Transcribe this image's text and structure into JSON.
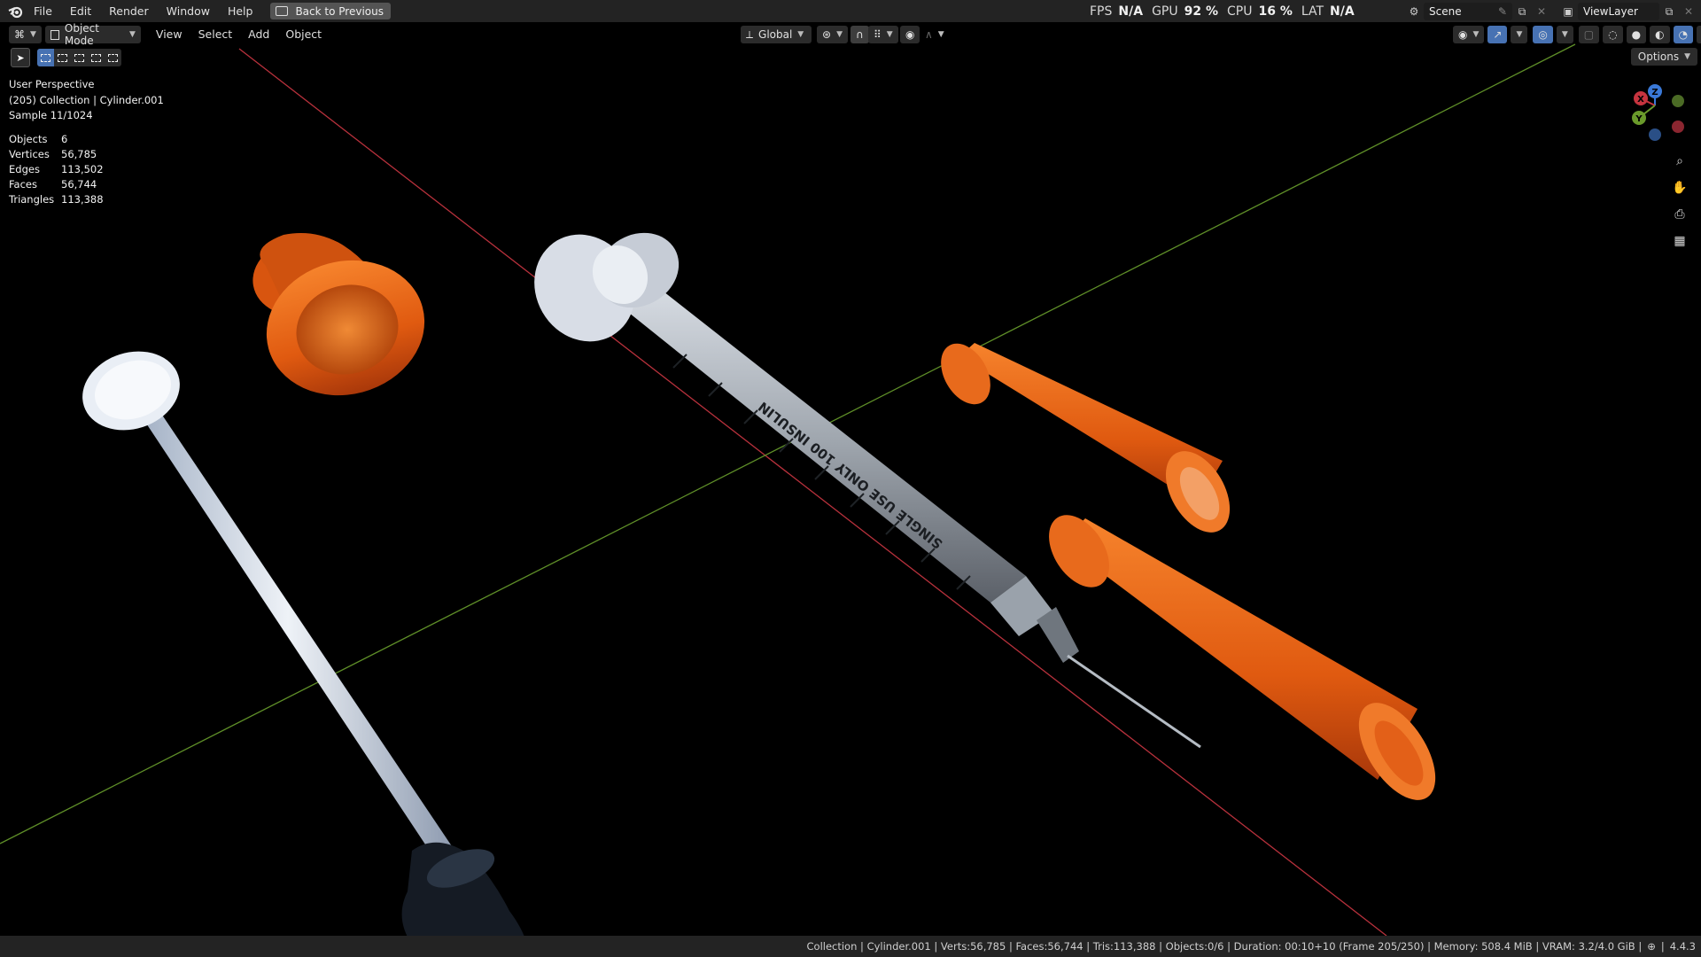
{
  "topbar": {
    "menus": [
      "File",
      "Edit",
      "Render",
      "Window",
      "Help"
    ],
    "back_label": "Back to Previous",
    "fps_label": "FPS",
    "fps_value": "N/A",
    "gpu_label": "GPU",
    "gpu_value": "92 %",
    "cpu_label": "CPU",
    "cpu_value": "16 %",
    "lat_label": "LAT",
    "lat_value": "N/A",
    "scene_name": "Scene",
    "view_layer": "ViewLayer"
  },
  "header": {
    "mode": "Object Mode",
    "menus": [
      "View",
      "Select",
      "Add",
      "Object"
    ],
    "transform_orientation": "Global",
    "options_label": "Options"
  },
  "viewport": {
    "perspective": "User Perspective",
    "collection_line": "(205) Collection | Cylinder.001",
    "sample": "Sample 11/1024",
    "stats": [
      {
        "label": "Objects",
        "value": "6"
      },
      {
        "label": "Vertices",
        "value": "56,785"
      },
      {
        "label": "Edges",
        "value": "113,502"
      },
      {
        "label": "Faces",
        "value": "56,744"
      },
      {
        "label": "Triangles",
        "value": "113,388"
      }
    ],
    "syringe_text": "SINGLE USE ONLY 100 INSULIN",
    "gizmo_axes": {
      "x": "X",
      "y": "Y",
      "z": "Z"
    },
    "colors": {
      "x_axis": "#c6343f",
      "y_axis": "#6a9a2b",
      "z_axis": "#3a79d8",
      "cap": "#e8641a"
    }
  },
  "statusbar": {
    "text": "Collection | Cylinder.001 | Verts:56,785 | Faces:56,744 | Tris:113,388 | Objects:0/6 | Duration: 00:10+10 (Frame 205/250) | Memory: 508.4 MiB | VRAM: 3.2/4.0 GiB |",
    "version": "4.4.3"
  }
}
